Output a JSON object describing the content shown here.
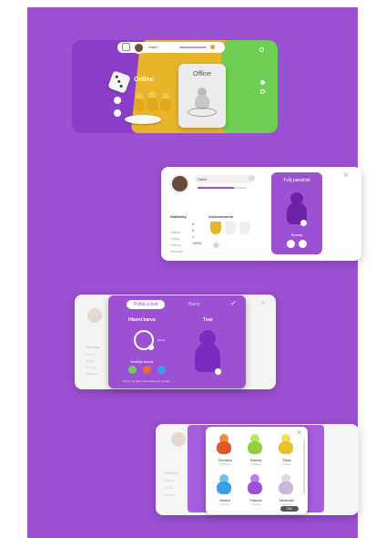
{
  "panel1": {
    "player_name": "Gabri",
    "online_label": "Online",
    "offline_label": "Offline",
    "colors": {
      "purple": "#8b3fc9",
      "yellow": "#e8b52a",
      "green": "#6fcf52"
    }
  },
  "panel2": {
    "player_name": "Gabri",
    "stats_title": "Statistiky",
    "achievements_title": "Achievements",
    "stats": [
      {
        "label": "Hráno",
        "value": "4"
      },
      {
        "label": "Výhry",
        "value": "3"
      },
      {
        "label": "Prohry",
        "value": "1"
      },
      {
        "label": "Winrate",
        "value": "100%"
      }
    ],
    "right_title": "Tvůj panáček",
    "bounty_label": "Bounty"
  },
  "panel3": {
    "tab_active": "Pošta a boti",
    "tab_other": "Barvy",
    "left_title": "Hlavní barva",
    "right_title": "Tvar",
    "multi_label": "Vedlejší barva",
    "dial_value": "barva",
    "side_labels": [
      "Statistiky",
      "Hráno",
      "Výhry",
      "Prohry",
      "Winrate"
    ],
    "footnote": "Změny se uloží automaticky po zavření"
  },
  "panel4": {
    "side_labels": [
      "Statistiky",
      "Hráno",
      "Výhry",
      "Prohry"
    ],
    "pawns": [
      {
        "name": "Červená",
        "sub": "Vybráno",
        "color": "#e2572a",
        "accent": "#f08a3c"
      },
      {
        "name": "Zelená",
        "sub": "Vybráno",
        "color": "#8fd13a",
        "accent": "#b7e864"
      },
      {
        "name": "Žlutá",
        "sub": "Vybráno",
        "color": "#e9c12a",
        "accent": "#f4dd5c"
      },
      {
        "name": "Modrá",
        "sub": "Vybráno",
        "color": "#3aa0e6",
        "accent": "#6cc2f2"
      },
      {
        "name": "Fialová",
        "sub": "Vybráno",
        "color": "#9b4fd8",
        "accent": "#c07df0"
      },
      {
        "name": "Neutrální",
        "sub": "Vybráno",
        "color": "#c9b8d6",
        "accent": "#e2d7ea"
      }
    ],
    "button_label": "OK"
  }
}
